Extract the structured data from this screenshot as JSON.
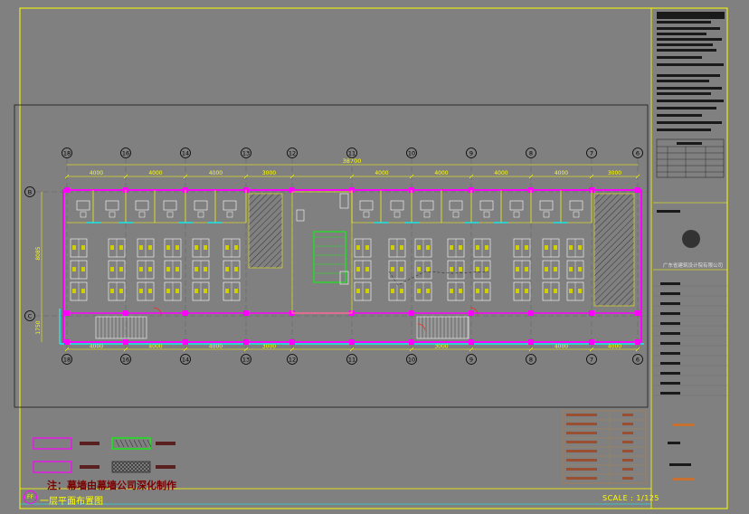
{
  "drawing": {
    "title": "一层平面布置图",
    "scale": "SCALE : 1/125",
    "note": "注：幕墙由幕墙公司深化制作",
    "sheet_id": "FF"
  },
  "dimensions": {
    "overall": "38700",
    "bays_top": [
      "4000",
      "4000",
      "4000",
      "3000",
      "4000",
      "4000",
      "4000",
      "4000",
      "3000"
    ],
    "bays_bottom": [
      "4000",
      "4000",
      "4000",
      "3000",
      "4000",
      "4000",
      "3000"
    ],
    "depth_main": "8085",
    "depth_corridor": "1750"
  },
  "axes": {
    "columns": [
      "18",
      "16",
      "14",
      "13",
      "12",
      "11",
      "10",
      "9",
      "8",
      "7",
      "6"
    ],
    "rows": [
      "B",
      "C"
    ]
  },
  "titleblock": {
    "company": "广东省建筑设计院有限公司"
  },
  "colors": {
    "background": "#808080",
    "lines": "#ffff00",
    "walls": "#ff00ff",
    "glass": "#00ffff",
    "furniture": "#ffffff",
    "stair": "#00ff00",
    "axis": "#000000"
  }
}
